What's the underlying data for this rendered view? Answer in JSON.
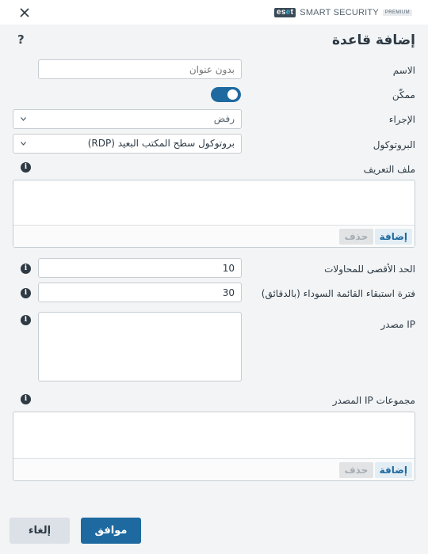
{
  "brand": {
    "logo_text": "eset",
    "product": "SMART SECURITY",
    "edition": "PREMIUM"
  },
  "dialog": {
    "title": "إضافة قاعدة",
    "help_symbol": "?"
  },
  "form": {
    "name": {
      "label": "الاسم",
      "value": "",
      "placeholder": "بدون عنوان"
    },
    "enabled": {
      "label": "ممكّن",
      "value": true
    },
    "action": {
      "label": "الإجراء",
      "value": "رفض"
    },
    "protocol": {
      "label": "البروتوكول",
      "value": "بروتوكول سطح المكتب البعيد (RDP)"
    },
    "profile": {
      "label": "ملف التعريف",
      "add_label": "إضافة",
      "delete_label": "حذف",
      "items": []
    },
    "max_attempts": {
      "label": "الحد الأقصى للمحاولات",
      "value": "10"
    },
    "blacklist_period": {
      "label": "فترة استبقاء القائمة السوداء (بالدقائق)",
      "value": "30"
    },
    "source_ip": {
      "label": "IP مصدر",
      "value": ""
    },
    "source_ip_groups": {
      "label": "مجموعات IP المصدر",
      "add_label": "إضافة",
      "delete_label": "حذف",
      "items": []
    }
  },
  "footer": {
    "ok_label": "موافق",
    "cancel_label": "إلغاء"
  },
  "colors": {
    "accent": "#1e6aa0",
    "background": "#f3f4f5",
    "text": "#2d3a45"
  }
}
